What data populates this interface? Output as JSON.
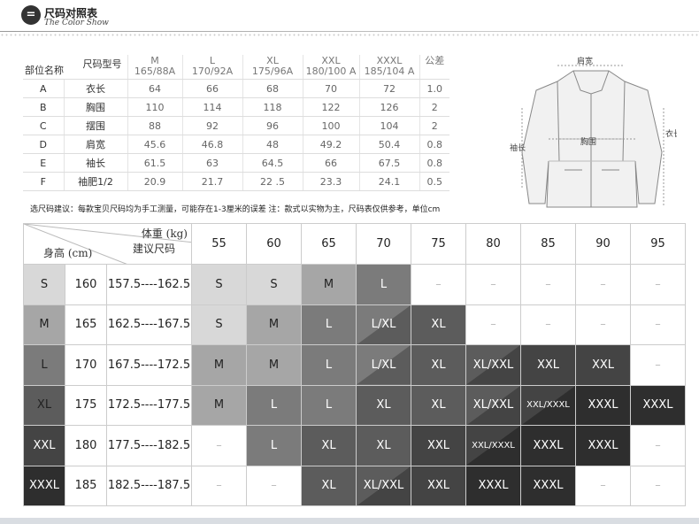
{
  "header": {
    "badge": "=",
    "title": "尺码对照表",
    "subtitle": "The Color Show"
  },
  "size_table": {
    "corner_top": "尺码型号",
    "corner_bottom": "部位名称",
    "sizes": [
      {
        "name": "M",
        "spec": "165/88A"
      },
      {
        "name": "L",
        "spec": "170/92A"
      },
      {
        "name": "XL",
        "spec": "175/96A"
      },
      {
        "name": "XXL",
        "spec": "180/100 A"
      },
      {
        "name": "XXXL",
        "spec": "185/104 A"
      }
    ],
    "tolerance_header": "公差",
    "rows": [
      {
        "code": "A",
        "name": "衣长",
        "values": [
          "64",
          "66",
          "68",
          "70",
          "72"
        ],
        "tolerance": "1.0"
      },
      {
        "code": "B",
        "name": "胸围",
        "values": [
          "110",
          "114",
          "118",
          "122",
          "126"
        ],
        "tolerance": "2"
      },
      {
        "code": "C",
        "name": "摆围",
        "values": [
          "88",
          "92",
          "96",
          "100",
          "104"
        ],
        "tolerance": "2"
      },
      {
        "code": "D",
        "name": "肩宽",
        "values": [
          "45.6",
          "46.8",
          "48",
          "49.2",
          "50.4"
        ],
        "tolerance": "0.8"
      },
      {
        "code": "E",
        "name": "袖长",
        "values": [
          "61.5",
          "63",
          "64.5",
          "66",
          "67.5"
        ],
        "tolerance": "0.8"
      },
      {
        "code": "F",
        "name": "袖肥1/2",
        "values": [
          "20.9",
          "21.7",
          "22 .5",
          "23.3",
          "24.1"
        ],
        "tolerance": "0.5"
      }
    ]
  },
  "jacket_labels": {
    "shoulder": "肩宽",
    "chest": "胸围",
    "sleeve": "袖长",
    "length": "衣长"
  },
  "note": "选尺码建议：每款宝贝尺码均为手工测量，可能存在1-3厘米的误差    注：款式以实物为主，尺码表仅供参考，单位cm",
  "recommendation": {
    "corner_weight": "体重 (kg)",
    "corner_size": "建议尺码",
    "corner_height": "身高 (cm)",
    "weights": [
      "55",
      "60",
      "65",
      "70",
      "75",
      "80",
      "85",
      "90",
      "95"
    ],
    "rows": [
      {
        "size": "S",
        "height": "160",
        "range": "157.5----162.5",
        "cells": [
          "S",
          "S",
          "M",
          "L",
          "–",
          "–",
          "–",
          "–",
          "–"
        ]
      },
      {
        "size": "M",
        "height": "165",
        "range": "162.5----167.5",
        "cells": [
          "S",
          "M",
          "L",
          "L/XL",
          "XL",
          "–",
          "–",
          "–",
          "–"
        ]
      },
      {
        "size": "L",
        "height": "170",
        "range": "167.5----172.5",
        "cells": [
          "M",
          "M",
          "L",
          "L/XL",
          "XL",
          "XL/XXL",
          "XXL",
          "XXL",
          "–"
        ]
      },
      {
        "size": "XL",
        "height": "175",
        "range": "172.5----177.5",
        "cells": [
          "M",
          "L",
          "L",
          "XL",
          "XL",
          "XL/XXL",
          "XXL/XXXL",
          "XXXL",
          "XXXL"
        ]
      },
      {
        "size": "XXL",
        "height": "180",
        "range": "177.5----182.5",
        "cells": [
          "–",
          "L",
          "XL",
          "XL",
          "XXL",
          "XXL/XXXL",
          "XXXL",
          "XXXL",
          "–"
        ]
      },
      {
        "size": "XXXL",
        "height": "185",
        "range": "182.5----187.5",
        "cells": [
          "–",
          "–",
          "XL",
          "XL/XXL",
          "XXL",
          "XXXL",
          "XXXL",
          "–",
          "–"
        ]
      }
    ]
  },
  "colors": {
    "S": "#d8d8d8",
    "M": "#a6a6a6",
    "L": "#7b7b7b",
    "XL": "#5c5c5c",
    "XXL": "#444444",
    "XXXL": "#2e2e2e",
    "dash": "#ffffff"
  }
}
